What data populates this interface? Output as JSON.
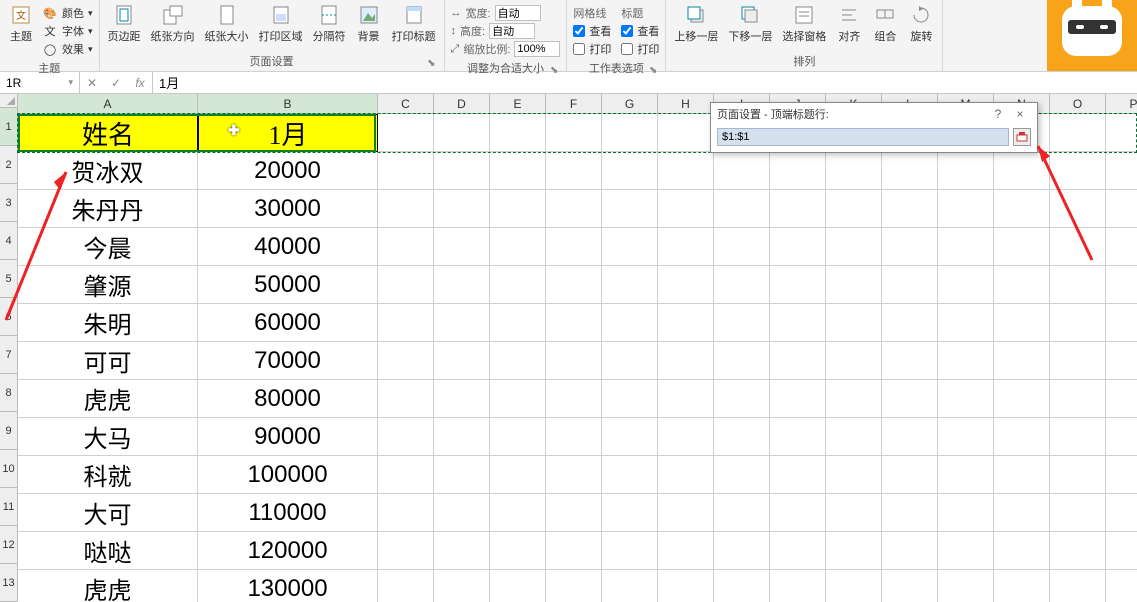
{
  "ribbon": {
    "groups": {
      "theme": {
        "label": "主题",
        "theme_btn": "主题",
        "colors": "颜色",
        "fonts": "字体",
        "effects": "效果"
      },
      "page_setup": {
        "label": "页面设置",
        "margins": "页边距",
        "orientation": "纸张方向",
        "size": "纸张大小",
        "print_area": "打印区域",
        "breaks": "分隔符",
        "background": "背景",
        "print_titles": "打印标题"
      },
      "scale": {
        "label": "调整为合适大小",
        "width_lbl": "宽度:",
        "width_val": "自动",
        "height_lbl": "高度:",
        "height_val": "自动",
        "scale_lbl": "缩放比例:",
        "scale_val": "100%"
      },
      "sheet_options": {
        "label": "工作表选项",
        "gridlines_lbl": "网格线",
        "headings_lbl": "标题",
        "view": "查看",
        "print": "打印"
      },
      "arrange": {
        "label": "排列",
        "bring_forward": "上移一层",
        "send_backward": "下移一层",
        "selection_pane": "选择窗格",
        "align": "对齐",
        "group": "组合",
        "rotate": "旋转"
      }
    }
  },
  "formula_bar": {
    "name_box": "1R",
    "fx": "fx",
    "formula": "1月"
  },
  "columns": [
    "A",
    "B",
    "C",
    "D",
    "E",
    "F",
    "G",
    "H",
    "I",
    "J",
    "K",
    "L",
    "M",
    "N",
    "O",
    "P"
  ],
  "rows": [
    "1",
    "2",
    "3",
    "4",
    "5",
    "6",
    "7",
    "8",
    "9",
    "10",
    "11",
    "12",
    "13"
  ],
  "cells": {
    "A1": "姓名",
    "B1": "1月",
    "A2": "贺冰双",
    "B2": "20000",
    "A3": "朱丹丹",
    "B3": "30000",
    "A4": "今晨",
    "B4": "40000",
    "A5": "肇源",
    "B5": "50000",
    "A6": "朱明",
    "B6": "60000",
    "A7": "可可",
    "B7": "70000",
    "A8": "虎虎",
    "B8": "80000",
    "A9": "大马",
    "B9": "90000",
    "A10": "科就",
    "B10": "100000",
    "A11": "大可",
    "B11": "110000",
    "A12": "哒哒",
    "B12": "120000",
    "A13": "虎虎",
    "B13": "130000"
  },
  "dialog": {
    "title": "页面设置 - 顶端标题行:",
    "value": "$1:$1",
    "help": "?",
    "close": "×"
  }
}
